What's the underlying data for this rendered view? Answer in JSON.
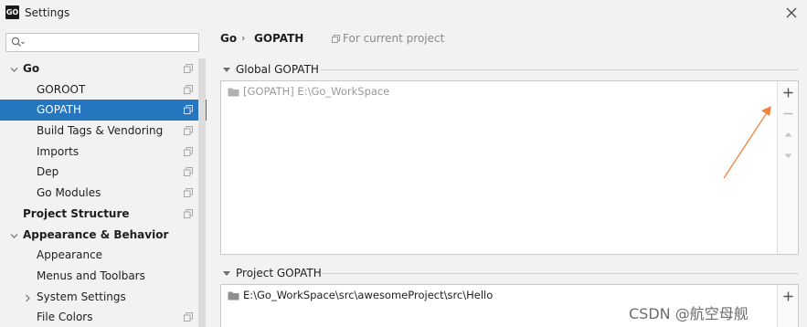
{
  "window": {
    "title": "Settings",
    "logo_text": "GO"
  },
  "search": {
    "placeholder": ""
  },
  "tree": [
    {
      "label": "Go",
      "bold": true,
      "level": 0,
      "arrow": "expanded",
      "copy": true,
      "name": "tree-item-go"
    },
    {
      "label": "GOROOT",
      "bold": false,
      "level": 1,
      "arrow": "",
      "copy": true,
      "name": "tree-item-goroot"
    },
    {
      "label": "GOPATH",
      "bold": false,
      "level": 1,
      "arrow": "",
      "copy": true,
      "selected": true,
      "name": "tree-item-gopath"
    },
    {
      "label": "Build Tags & Vendoring",
      "bold": false,
      "level": 1,
      "arrow": "",
      "copy": true,
      "name": "tree-item-build-tags"
    },
    {
      "label": "Imports",
      "bold": false,
      "level": 1,
      "arrow": "",
      "copy": true,
      "name": "tree-item-imports"
    },
    {
      "label": "Dep",
      "bold": false,
      "level": 1,
      "arrow": "",
      "copy": true,
      "name": "tree-item-dep"
    },
    {
      "label": "Go Modules",
      "bold": false,
      "level": 1,
      "arrow": "",
      "copy": true,
      "name": "tree-item-go-modules"
    },
    {
      "label": "Project Structure",
      "bold": true,
      "level": 0,
      "arrow": "",
      "copy": true,
      "name": "tree-item-project-structure"
    },
    {
      "label": "Appearance & Behavior",
      "bold": true,
      "level": 0,
      "arrow": "expanded",
      "copy": false,
      "name": "tree-item-appearance-behavior"
    },
    {
      "label": "Appearance",
      "bold": false,
      "level": 1,
      "arrow": "",
      "copy": false,
      "name": "tree-item-appearance"
    },
    {
      "label": "Menus and Toolbars",
      "bold": false,
      "level": 1,
      "arrow": "",
      "copy": false,
      "name": "tree-item-menus-toolbars"
    },
    {
      "label": "System Settings",
      "bold": false,
      "level": 1,
      "arrow": "collapsed",
      "copy": false,
      "name": "tree-item-system-settings"
    },
    {
      "label": "File Colors",
      "bold": false,
      "level": 1,
      "arrow": "",
      "copy": true,
      "name": "tree-item-file-colors"
    }
  ],
  "breadcrumb": {
    "parent": "Go",
    "separator": "›",
    "current": "GOPATH",
    "scope_label": "For current project"
  },
  "global_gopath": {
    "title": "Global GOPATH",
    "entries": [
      "[GOPATH] E:\\Go_WorkSpace"
    ]
  },
  "project_gopath": {
    "title": "Project GOPATH",
    "entries": [
      "E:\\Go_WorkSpace\\src\\awesomeProject\\src\\Hello"
    ]
  },
  "toolbar_icons": [
    "plus-icon",
    "minus-icon",
    "move-up-icon",
    "move-down-icon"
  ],
  "annotation": {
    "color": "#f0843c"
  },
  "watermark": "CSDN @航空母舰",
  "colors": {
    "selection": "#2675bf",
    "accent_arrow": "#f0843c"
  }
}
